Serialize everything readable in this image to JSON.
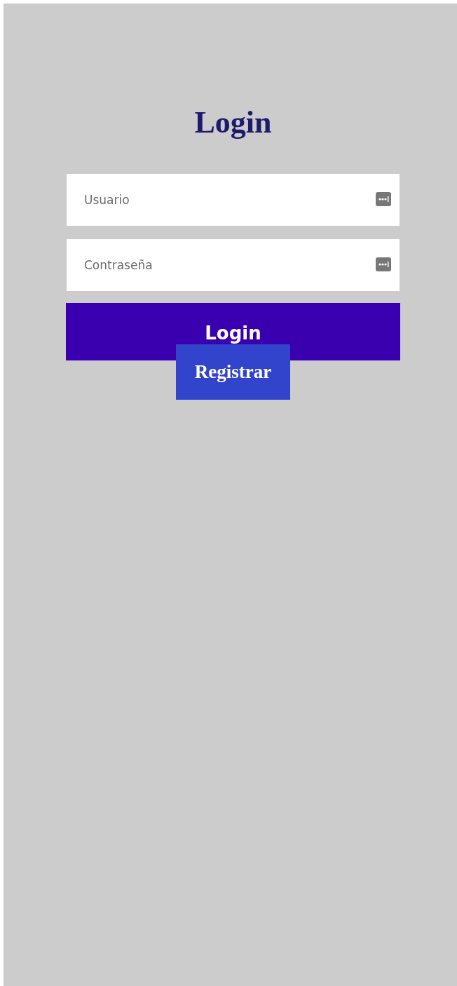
{
  "title": "Login",
  "fields": [
    {
      "placeholder": "Usuario"
    },
    {
      "placeholder": "Contraseña"
    }
  ],
  "login_button": "Login",
  "register_button": "Registrar"
}
